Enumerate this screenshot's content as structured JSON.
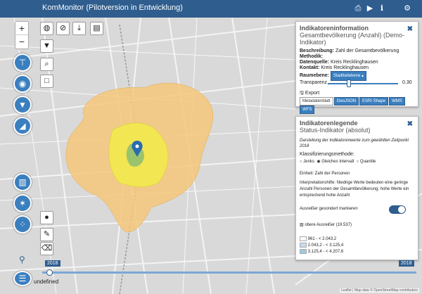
{
  "header": {
    "title": "KomMonitor (Pilotversion in Entwicklung)",
    "icons": [
      "print-icon",
      "play-icon",
      "info-icon",
      "user-settings-icon"
    ]
  },
  "map": {
    "zoom_in": "+",
    "zoom_out": "−",
    "attribution": "Leaflet | Map data © OpenStreetMap contributors"
  },
  "indicator_info": {
    "heading": "Indikatoreninformation",
    "subtitle": "Gesamtbevölkerung (Anzahl) (Demo-Indikator)",
    "beschreibung_label": "Beschreibung:",
    "beschreibung": "Zahl der Gesamtbevölkerung",
    "methodik_label": "Methodik:",
    "datenquelle_label": "Datenquelle:",
    "datenquelle": "Kreis Recklinghausen",
    "kontakt_label": "Kontakt:",
    "kontakt": "Kreis Recklinghausen",
    "raumebene_label": "Raumebene:",
    "raumebene": "Stadtteilebene",
    "transparenz_label": "Transparenz",
    "transparenz_value": "0.30",
    "transparency": 0.3,
    "export_label": "Export",
    "export_buttons": [
      "Metadatenblatt",
      "GeoJSON",
      "ESRI Shape",
      "WMS",
      "WFS"
    ]
  },
  "legend": {
    "heading": "Indikatorenlegende",
    "subtitle": "Status-Indikator (absolut)",
    "desc": "Darstellung der Indikatorenwerte zum gewählten Zeitpunkt 2018",
    "klass_label": "Klassifizierungsmethode:",
    "methods": [
      "Jenks",
      "Gleiches Intervall",
      "Quantile"
    ],
    "einheit": "Einheit: Zahl der Personen",
    "interpretation": "Interpretationshilfe: Niedrige Werte bedeuten eine geringe Anzahl Personen der Gesamtbevölkerung, hohe Werte ein entsprechend hohe Anzahl",
    "outlier_label": "Ausreißer gesondert markieren",
    "upper_outlier": "obere Ausreißer (19.537)",
    "classes": [
      "961 - < 2.043,2",
      "2.043,2 - < 3.125,4",
      "3.125,4 - < 4.207,6"
    ],
    "class_colors": [
      "#f7fbff",
      "#c6dbef",
      "#9ecae1"
    ]
  },
  "time": {
    "start_year": "2018",
    "end_year": "2018",
    "undefined_label": "undefined"
  },
  "colors": {
    "header": "#2e5d8e",
    "accent": "#3a7fbf",
    "orange_area": "#f5c77a",
    "yellow_area": "#f2e94e",
    "green_area": "#9bc36b"
  }
}
